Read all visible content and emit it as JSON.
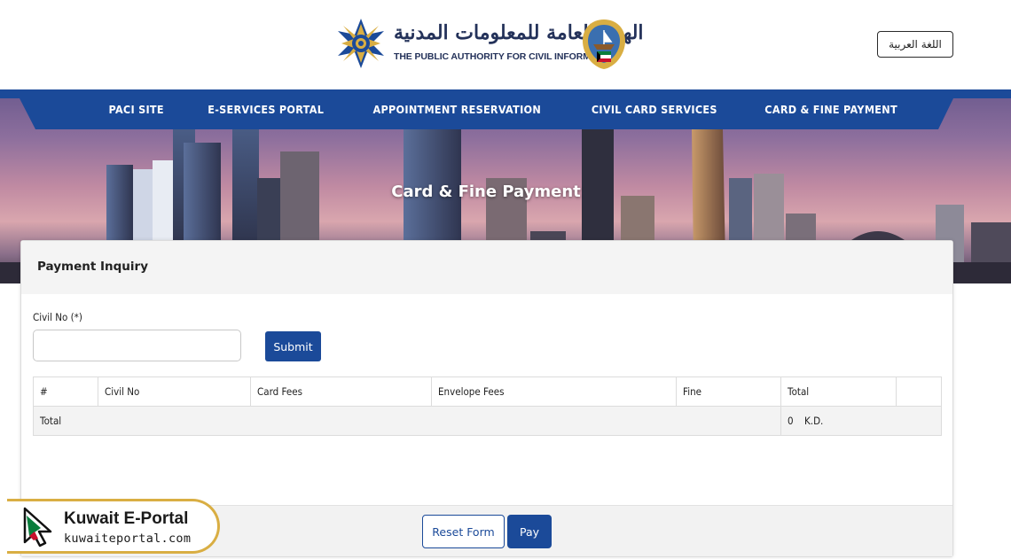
{
  "header": {
    "logo_arabic": "الهيئة العامة للمعلومات المدنية",
    "logo_english": "THE PUBLIC AUTHORITY FOR CIVIL INFORMATION",
    "language_button": "اللغة العربية"
  },
  "nav": {
    "items": [
      {
        "label": "PACI SITE"
      },
      {
        "label": "E-SERVICES PORTAL"
      },
      {
        "label": "APPOINTMENT RESERVATION"
      },
      {
        "label": "CIVIL CARD SERVICES"
      },
      {
        "label": "CARD & FINE PAYMENT"
      }
    ],
    "bar_color": "#1b4a99"
  },
  "banner": {
    "title": "Card & Fine Payment"
  },
  "form": {
    "title": "Payment Inquiry",
    "civil_label": "Civil No (*)",
    "civil_value": "",
    "civil_placeholder": "",
    "submit_label": "Submit"
  },
  "table": {
    "headers": [
      "#",
      "Civil No",
      "Card Fees",
      "Envelope Fees",
      "Fine",
      "Total",
      ""
    ],
    "total_row": {
      "label": "Total",
      "amount": "0",
      "currency": "K.D."
    }
  },
  "footer": {
    "reset_label": "Reset Form",
    "pay_label": "Pay"
  },
  "watermark": {
    "title": "Kuwait E-Portal",
    "url": "kuwaiteportal.com"
  },
  "colors": {
    "primary": "#1b4a99",
    "watermark_border": "#d9ae43",
    "logo_text": "#24325a"
  }
}
